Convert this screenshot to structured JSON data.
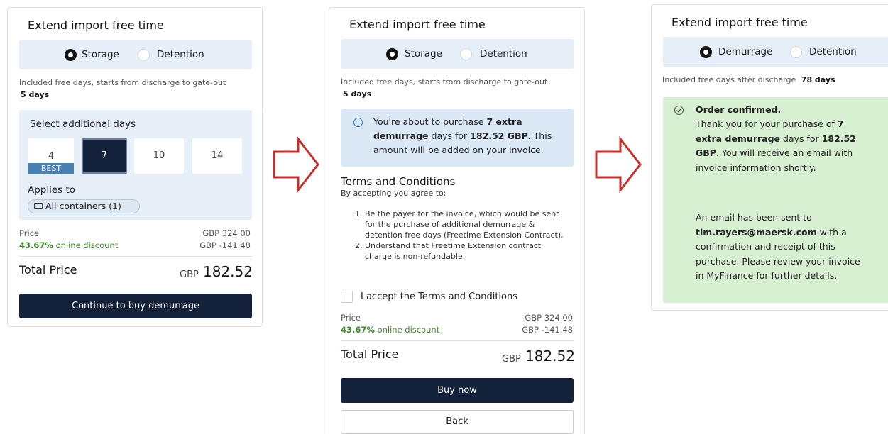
{
  "panel1": {
    "title": "Extend import free time",
    "tabs": [
      {
        "label": "Storage",
        "selected": true
      },
      {
        "label": "Detention",
        "selected": false
      }
    ],
    "included_text": "Included free days, starts from discharge to gate-out",
    "included_days": "5 days",
    "select_label": "Select additional days",
    "day_options": [
      {
        "value": "4",
        "badge": "BEST",
        "selected": false
      },
      {
        "value": "7",
        "selected": true
      },
      {
        "value": "10",
        "selected": false
      },
      {
        "value": "14",
        "selected": false
      }
    ],
    "applies_label": "Applies to",
    "applies_chip": "All containers (1)",
    "price_label": "Price",
    "price_value": "GBP 324.00",
    "discount_pct": "43.67%",
    "discount_label": "online discount",
    "discount_value": "GBP -141.48",
    "total_label": "Total Price",
    "total_currency": "GBP",
    "total_value": "182.52",
    "cta": "Continue to buy demurrage"
  },
  "panel2": {
    "title": "Extend import free time",
    "tabs": [
      {
        "label": "Storage",
        "selected": true
      },
      {
        "label": "Detention",
        "selected": false
      }
    ],
    "included_text": "Included free days, starts from discharge to gate-out",
    "included_days": "5 days",
    "info": {
      "prefix": "You're about to purchase ",
      "days": "7 extra demurrage",
      "mid": " days for ",
      "amount": "182.52 GBP",
      "suffix": ". This amount will be added on your invoice."
    },
    "terms_title": "Terms and Conditions",
    "terms_sub": "By accepting you agree to:",
    "terms": [
      "Be the payer for the invoice, which would be sent for the purchase of additional demurrage & detention free days (Freetime Extension Contract).",
      "Understand that Freetime Extension contract charge is non-refundable."
    ],
    "accept_label": "I accept the Terms and Conditions",
    "price_label": "Price",
    "price_value": "GBP 324.00",
    "discount_pct": "43.67%",
    "discount_label": "online discount",
    "discount_value": "GBP -141.48",
    "total_label": "Total Price",
    "total_currency": "GBP",
    "total_value": "182.52",
    "buy": "Buy now",
    "back": "Back"
  },
  "panel3": {
    "title": "Extend import free time",
    "tabs": [
      {
        "label": "Demurrage",
        "selected": true
      },
      {
        "label": "Detention",
        "selected": false
      }
    ],
    "included_text": "Included free days after discharge",
    "included_days": "78 days",
    "confirm_title": "Order confirmed.",
    "confirm": {
      "p1_prefix": "Thank you for your purchase of ",
      "p1_days": "7 extra demurrage",
      "p1_mid": " days for ",
      "p1_amount": "182.52 GBP",
      "p1_suffix": ". You will receive an email with invoice information shortly.",
      "p2_prefix": "An email has been sent to ",
      "p2_email": "tim.rayers@maersk.com",
      "p2_suffix": " with a confirmation and receipt of this purchase. Please review your invoice in MyFinance for further details."
    }
  },
  "colors": {
    "navy": "#13213a",
    "light_blue": "#e6eef7",
    "info_blue": "#dbe8f5",
    "success_green": "#d8f0d2",
    "discount_green": "#3f8a2c",
    "arrow_red": "#c8302c"
  }
}
